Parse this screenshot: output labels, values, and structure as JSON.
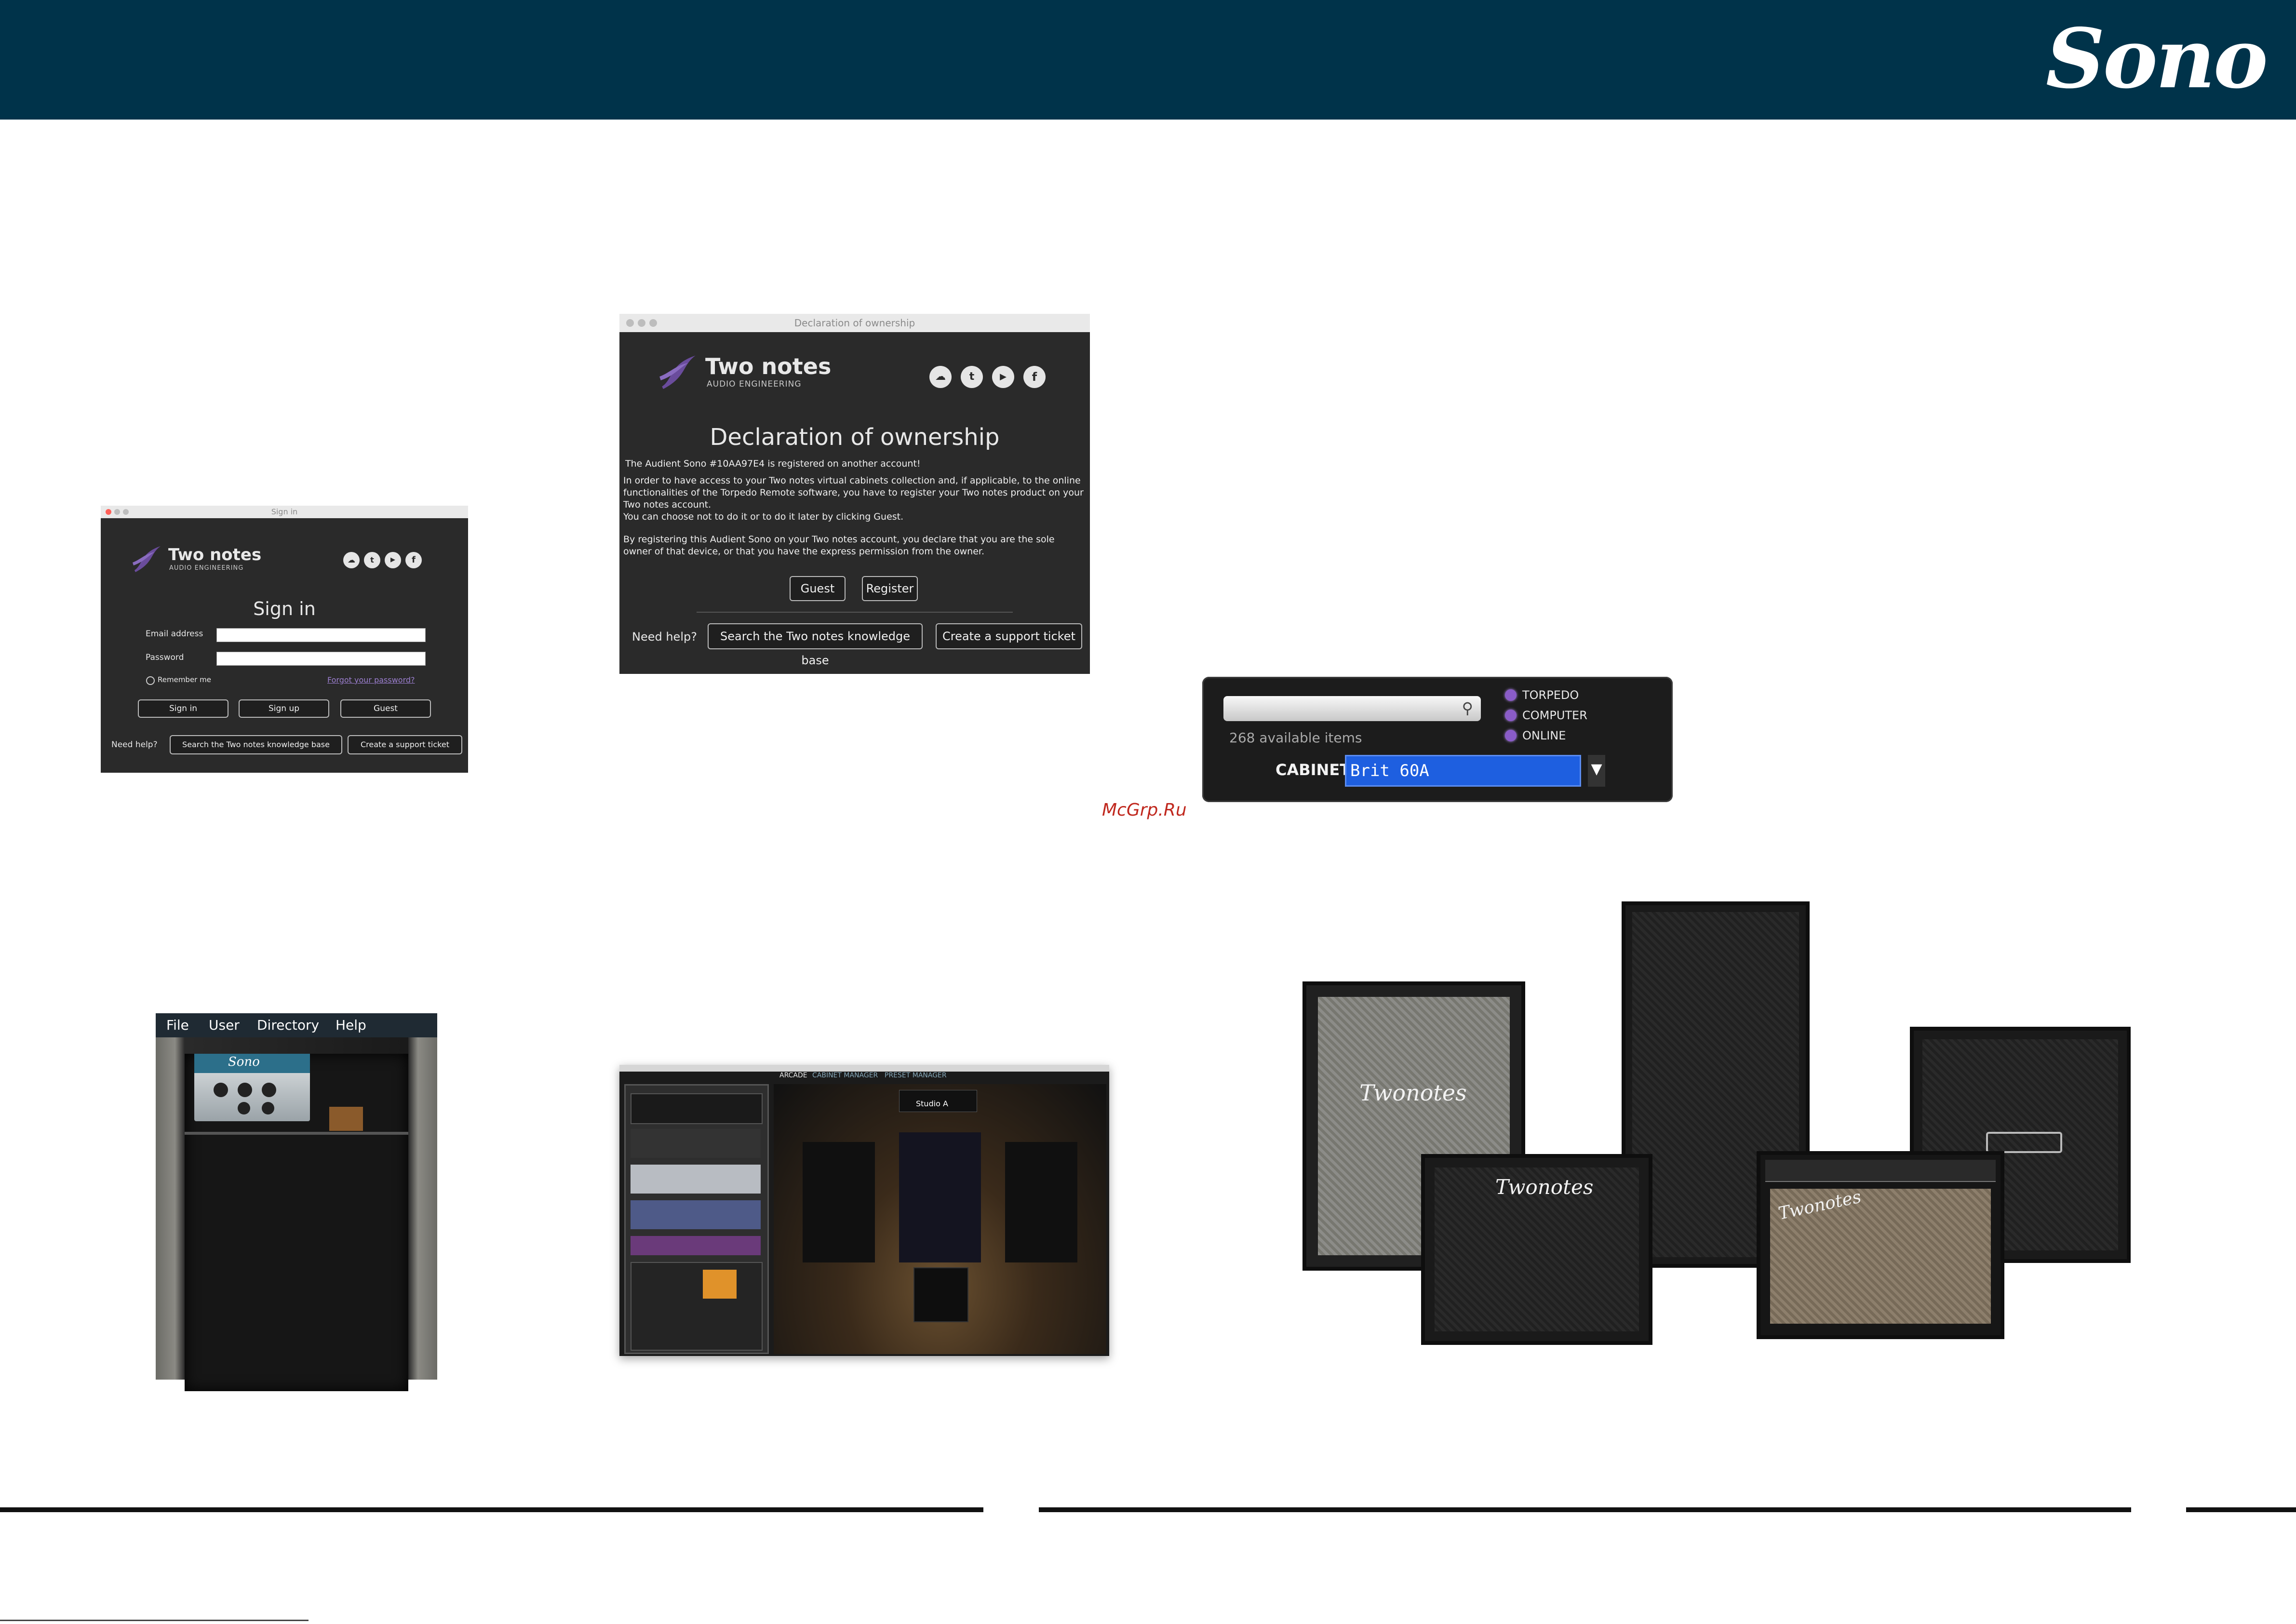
{
  "header": {
    "brand": "Sono",
    "bg_color": "#00334a"
  },
  "signin_window": {
    "title": "Sign in",
    "logo_title": "Two notes",
    "logo_subtitle": "AUDIO ENGINEERING",
    "heading": "Sign in",
    "email_label": "Email address",
    "password_label": "Password",
    "remember_label": "Remember me",
    "forgot_link": "Forgot your password?",
    "signin_button": "Sign in",
    "signup_button": "Sign up",
    "guest_button": "Guest",
    "need_help": "Need help?",
    "kb_button": "Search the Two notes knowledge base",
    "ticket_button": "Create a support ticket"
  },
  "ownership_window": {
    "title": "Declaration of ownership",
    "logo_title": "Two notes",
    "logo_subtitle": "AUDIO ENGINEERING",
    "heading": "Declaration of ownership",
    "line1": "The Audient Sono #10AA97E4 is registered on another account!",
    "para1": "In order to have access to your Two notes virtual cabinets collection and, if applicable, to the online functionalities of the Torpedo Remote software, you have to register your Two notes product on your Two notes account.",
    "para2": "You can choose not to do it or to do it later by clicking Guest.",
    "para3": "By registering this Audient Sono on your Two notes account, you declare that you are the sole owner of that device, or that you have the express permission from the owner.",
    "guest_button": "Guest",
    "register_button": "Register",
    "need_help": "Need help?",
    "kb_button": "Search the Two notes knowledge base",
    "ticket_button": "Create a support ticket"
  },
  "cabinet_browser": {
    "available": "268 available items",
    "options": [
      "TORPEDO",
      "COMPUTER",
      "ONLINE"
    ],
    "cabinet_label": "CABINET",
    "cabinet_value": "Brit 60A"
  },
  "watermark": "McGrp.Ru",
  "rack_window": {
    "menu": [
      "File",
      "User",
      "Directory",
      "Help"
    ],
    "device_label": "Sono"
  },
  "remote_window": {
    "tabs": [
      "ARCADE",
      "CABINET MANAGER",
      "PRESET MANAGER"
    ],
    "studio": "Studio A"
  },
  "cabinets_photo": {
    "logos": [
      "Twonotes",
      "Twonotes",
      "Twonotes"
    ]
  }
}
